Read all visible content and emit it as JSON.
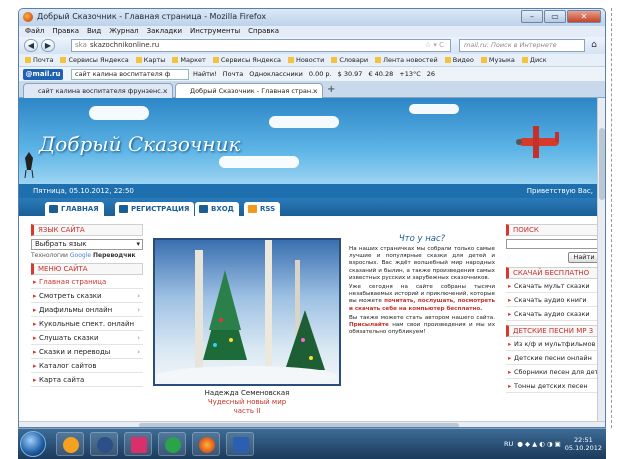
{
  "window": {
    "title": "Добрый Сказочник - Главная страница - Mozilla Firefox"
  },
  "menu": [
    "Файл",
    "Правка",
    "Вид",
    "Журнал",
    "Закладки",
    "Инструменты",
    "Справка"
  ],
  "nav": {
    "url": "skazochnikonline.ru",
    "url_prefix": "ska",
    "search_placeholder": "mail.ru: Поиск в Интернете"
  },
  "bookmarks": [
    "Почта",
    "Сервисы Яндекса",
    "Карты",
    "Маркет",
    "Сервисы Яндекса",
    "Новости",
    "Словари",
    "Лента новостей",
    "Видео",
    "Музыка",
    "Диск"
  ],
  "mailbar": {
    "logo": "@mail.ru",
    "search_value": "сайт калина воспитателя ф",
    "find": "Найти!",
    "items": [
      "Почта",
      "Одноклассники",
      "0.00 р.",
      "$ 30.97",
      "€ 40.28",
      "+13°C",
      "26"
    ]
  },
  "tabs": [
    {
      "label": "сайт калина воспитателя фрунзенс..."
    },
    {
      "label": "Добрый Сказочник - Главная стран..."
    }
  ],
  "site": {
    "title": "Добрый Сказочник",
    "date": "Пятница, 05.10.2012, 22:50",
    "greeting": "Приветствую Вас,",
    "tabs": [
      "ГЛАВНАЯ",
      "РЕГИСТРАЦИЯ",
      "ВХОД",
      "RSS"
    ],
    "lang_head": "ЯЗЫК САЙТА",
    "lang_select": "Выбрать язык",
    "gtrans_prefix": "Технологии",
    "gtrans_google": "Google",
    "gtrans_suffix": "Переводчик",
    "menu_head": "МЕНЮ САЙТА",
    "menu": [
      "Главная страница",
      "Смотреть сказки",
      "Диафильмы онлайн",
      "Кукольные спект. онлайн",
      "Слушать сказки",
      "Сказки и переводы",
      "Каталог сайтов",
      "Карта сайта"
    ],
    "caption": [
      "Надежда Семеновская",
      "Чудесный новый мир",
      "часть II"
    ],
    "what_head": "Что у нас?",
    "p1": "На наших страничках мы собрали только самые лучшие и популярные сказки для детей и взрослых. Вас ждёт волшебный мир народных сказаний и былин, а также произведения самых известных русских и зарубежных сказочников.",
    "p2a": "Уже сегодня на сайте собраны тысячи незабываемых историй и приключений, которые вы можете",
    "p2b": "почитать, послушать, посмотреть и скачать себе на компьютер бесплатно.",
    "p3a": "Вы также можете стать автором нашего сайта.",
    "p3b": "Присылайте",
    "p3c": "нам свои произведения и мы их обязательно опубликуем!",
    "search_head": "ПОИСК",
    "search_btn": "Найти",
    "dl_head": "СКАЧАЙ БЕСПЛАТНО",
    "dl": [
      "Скачать мульт сказки",
      "Скачать аудио книги",
      "Скачать аудио сказки"
    ],
    "songs_head": "ДЕТСКИЕ ПЕСНИ МР 3",
    "songs": [
      "Из к/ф и мультфильмов",
      "Детские песни онлайн",
      "Сборники песен для дет",
      "Тонны детских песен"
    ]
  },
  "taskbar": {
    "lang": "RU",
    "time": "22:51",
    "date": "05.10.2012"
  },
  "colors": {
    "accent": "#1e6fae",
    "red": "#c8302a"
  }
}
